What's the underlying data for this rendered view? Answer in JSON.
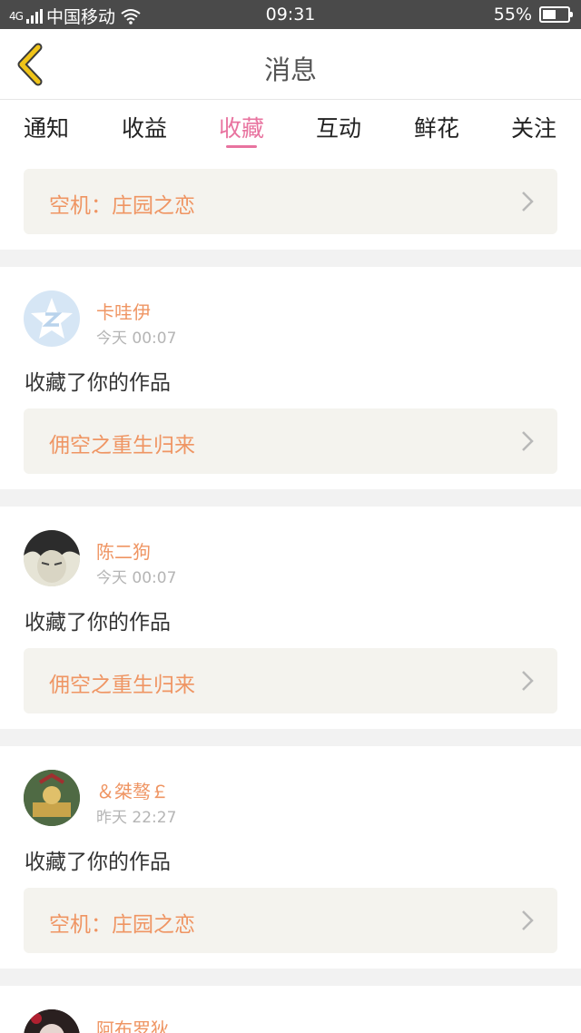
{
  "status": {
    "signal": "4G",
    "carrier": "中国移动",
    "time": "09:31",
    "battery": "55%",
    "battery_level": 0.55
  },
  "header": {
    "title": "消息",
    "accent_color": "#f0c419"
  },
  "tabs": [
    {
      "label": "通知"
    },
    {
      "label": "收益"
    },
    {
      "label": "收藏",
      "active": true
    },
    {
      "label": "互动"
    },
    {
      "label": "鲜花"
    },
    {
      "label": "关注"
    }
  ],
  "top_item": {
    "book": "空机：庄园之恋"
  },
  "items": [
    {
      "user": "卡哇伊",
      "time": "今天 00:07",
      "action": "收藏了你的作品",
      "book": "佣空之重生归来",
      "avatar": "qq-default-avatar"
    },
    {
      "user": "陈二狗",
      "time": "今天 00:07",
      "action": "收藏了你的作品",
      "book": "佣空之重生归来",
      "avatar": "anime-character-avatar"
    },
    {
      "user": "＆桀骜￡",
      "time": "昨天 22:27",
      "action": "收藏了你的作品",
      "book": "空机：庄园之恋",
      "avatar": "game-scene-avatar"
    },
    {
      "user": "阿布罗狄",
      "avatar": "dark-character-avatar"
    }
  ],
  "colors": {
    "tab_active": "#e8739f",
    "username": "#ef9563",
    "book_title": "#ef9563",
    "book_bg": "#f4f3ee"
  }
}
